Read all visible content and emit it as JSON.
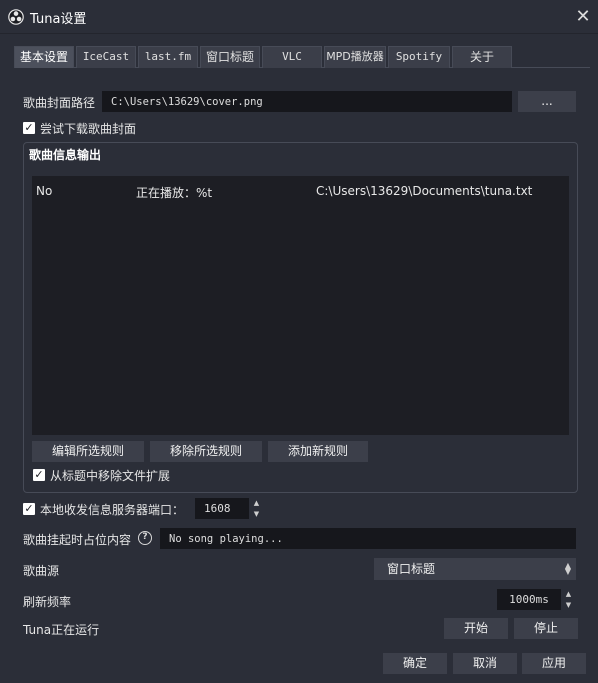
{
  "window": {
    "title": "Tuna设置",
    "close_glyph": "✕"
  },
  "tabs": [
    {
      "label": "基本设置",
      "active": true
    },
    {
      "label": "IceCast"
    },
    {
      "label": "last.fm"
    },
    {
      "label": "窗口标题"
    },
    {
      "label": "VLC"
    },
    {
      "label": "MPD播放器"
    },
    {
      "label": "Spotify"
    },
    {
      "label": "关于"
    }
  ],
  "cover": {
    "label": "歌曲封面路径",
    "value": "C:\\Users\\13629\\cover.png",
    "browse_label": "..."
  },
  "try_download": {
    "checked_glyph": "✓",
    "label": "尝试下载歌曲封面"
  },
  "song_output": {
    "title": "歌曲信息输出",
    "rows": [
      {
        "enabled": "No",
        "format": "正在播放：%t",
        "path": "C:\\Users\\13629\\Documents\\tuna.txt"
      }
    ],
    "edit_label": "编辑所选规则",
    "remove_label": "移除所选规则",
    "add_label": "添加新规则",
    "remove_ext_glyph": "✓",
    "remove_ext_label": "从标题中移除文件扩展"
  },
  "local_server": {
    "checked_glyph": "✓",
    "label": "本地收发信息服务器端口：",
    "port": "1608",
    "up_glyph": "▲",
    "down_glyph": "▼"
  },
  "placeholder": {
    "label": "歌曲挂起时占位内容",
    "help_glyph": "?",
    "value": "No song playing..."
  },
  "source": {
    "label": "歌曲源",
    "selected": "窗口标题",
    "up_glyph": "▲",
    "down_glyph": "▼"
  },
  "refresh": {
    "label": "刷新频率",
    "value": "1000ms",
    "up_glyph": "▲",
    "down_glyph": "▼"
  },
  "status": {
    "text": "Tuna正在运行",
    "start_label": "开始",
    "stop_label": "停止"
  },
  "footer": {
    "ok_label": "确定",
    "cancel_label": "取消",
    "apply_label": "应用"
  }
}
